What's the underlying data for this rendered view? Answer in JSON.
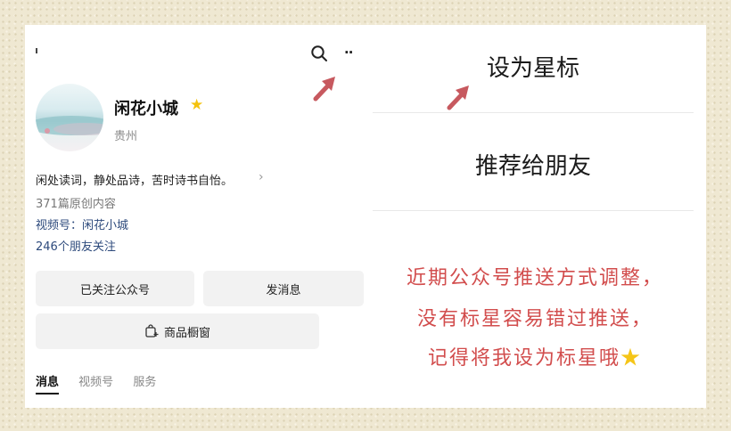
{
  "profile": {
    "name": "闲花小城",
    "location": "贵州",
    "bio": "闲处读词，静处品诗，苦时诗书自怡。",
    "articles": "371篇原创内容",
    "video": "视频号：闲花小城",
    "friends": "246个朋友关注"
  },
  "buttons": {
    "follow": "已关注公众号",
    "message": "发消息",
    "shop": "商品橱窗"
  },
  "tabs": [
    "消息",
    "视频号",
    "服务"
  ],
  "menu": {
    "set_star": "设为星标",
    "recommend": "推荐给朋友"
  },
  "notice": {
    "line1": "近期公众号推送方式调整，",
    "line2": "没有标星容易错过推送，",
    "line3": "记得将我设为标星哦"
  },
  "icons": {
    "search": "search-icon",
    "more": "more-icon",
    "star": "star-icon",
    "arrow": "pointer-arrow-icon",
    "shop": "shop-window-icon"
  },
  "colors": {
    "notice_red": "#d24d4d",
    "arrow_red": "#c7595f",
    "star_gold": "#f4c20d",
    "link_blue": "#2d4a7c"
  }
}
